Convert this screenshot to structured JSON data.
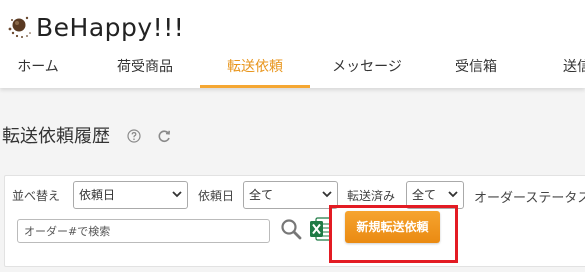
{
  "app": {
    "logo_text": "BeHappy!!!"
  },
  "nav": {
    "items": [
      {
        "label": "ホーム"
      },
      {
        "label": "荷受商品"
      },
      {
        "label": "転送依頼"
      },
      {
        "label": "メッセージ"
      },
      {
        "label": "受信箱"
      },
      {
        "label": "送信"
      }
    ],
    "active_index": 2
  },
  "page": {
    "title": "転送依頼履歴"
  },
  "filters": {
    "sort_label": "並べ替え",
    "sort_value": "依頼日",
    "date_label": "依頼日",
    "date_value": "全て",
    "transferred_label": "転送済み",
    "transferred_value": "全て",
    "order_status_label": "オーダーステータス"
  },
  "search": {
    "placeholder": "オーダー#で検索"
  },
  "actions": {
    "new_transfer_label": "新規転送依頼"
  },
  "colors": {
    "accent": "#f5a733",
    "button": "#ef951e",
    "highlight": "#e31b23",
    "excel": "#1e7b45"
  },
  "icons": [
    "logo-mark-icon",
    "help-icon",
    "refresh-icon",
    "chevron-down-icon",
    "search-icon",
    "excel-icon"
  ]
}
